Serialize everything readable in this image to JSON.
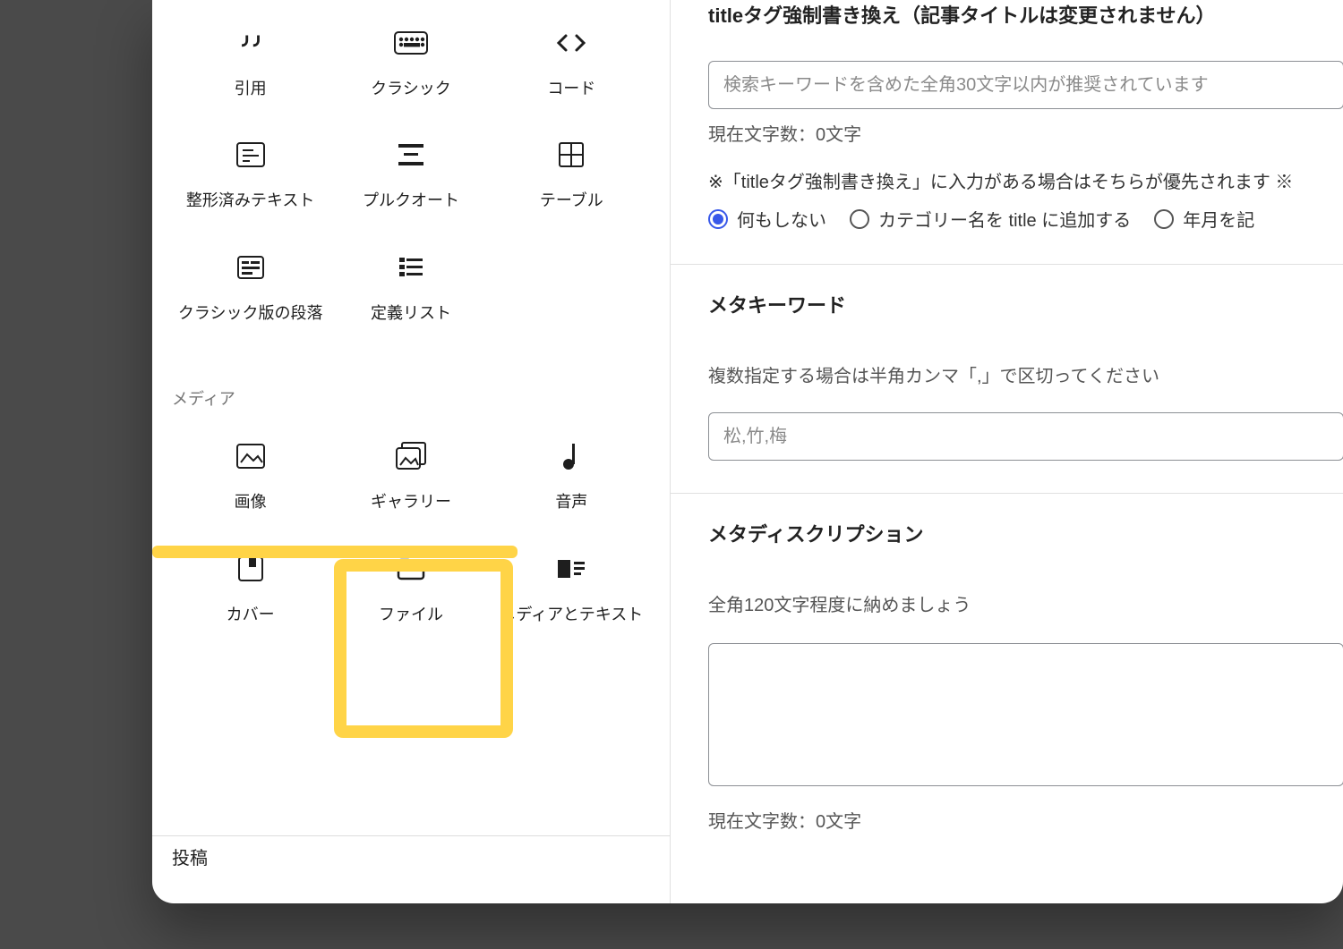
{
  "blocks": {
    "text_section": [
      {
        "label": "引用",
        "icon": "quote"
      },
      {
        "label": "クラシック",
        "icon": "keyboard"
      },
      {
        "label": "コード",
        "icon": "code"
      },
      {
        "label": "整形済みテキスト",
        "icon": "preformatted"
      },
      {
        "label": "プルクオート",
        "icon": "pullquote"
      },
      {
        "label": "テーブル",
        "icon": "table"
      },
      {
        "label": "クラシック版の段落",
        "icon": "classic-paragraph"
      },
      {
        "label": "定義リスト",
        "icon": "definition-list"
      }
    ],
    "media_section_title": "メディア",
    "media_section": [
      {
        "label": "画像",
        "icon": "image"
      },
      {
        "label": "ギャラリー",
        "icon": "gallery"
      },
      {
        "label": "音声",
        "icon": "audio"
      },
      {
        "label": "カバー",
        "icon": "cover"
      },
      {
        "label": "ファイル",
        "icon": "file"
      },
      {
        "label": "メディアとテキスト",
        "icon": "media-text"
      }
    ]
  },
  "bottom_bar": "投稿",
  "right": {
    "title_override": {
      "label": "titleタグ強制書き換え（記事タイトルは変更されません）",
      "placeholder": "検索キーワードを含めた全角30文字以内が推奨されています",
      "char_count": "現在文字数：0文字",
      "note": "※「titleタグ強制書き換え」に入力がある場合はそちらが優先されます ※",
      "radio1": "何もしない",
      "radio2": "カテゴリー名を title に追加する",
      "radio3": "年月を記"
    },
    "meta_keywords": {
      "label": "メタキーワード",
      "hint": "複数指定する場合は半角カンマ「,」で区切ってください",
      "placeholder": "松,竹,梅"
    },
    "meta_description": {
      "label": "メタディスクリプション",
      "hint": "全角120文字程度に納めましょう",
      "char_count": "現在文字数：0文字"
    }
  }
}
